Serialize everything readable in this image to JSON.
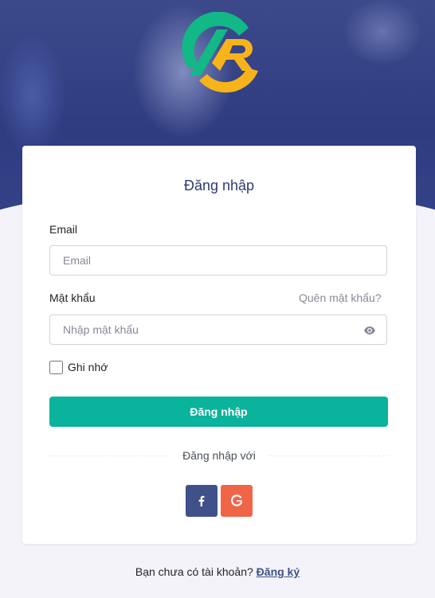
{
  "login": {
    "title": "Đăng nhập",
    "email_label": "Email",
    "email_placeholder": "Email",
    "password_label": "Mật khẩu",
    "forgot_link": "Quên mật khẩu?",
    "password_placeholder": "Nhập mật khẩu",
    "remember_label": "Ghi nhớ",
    "submit_label": "Đăng nhập",
    "divider_text": "Đăng nhập với",
    "social": {
      "facebook_icon": "facebook-icon",
      "google_icon": "google-icon"
    }
  },
  "footer": {
    "prompt": "Bạn chưa có tài khoản?",
    "register_link": "Đăng ký"
  },
  "colors": {
    "primary": "#0ab39c",
    "hero": "#2f3c80",
    "facebook": "#405189",
    "google": "#f06548",
    "logo_green": "#12b886",
    "logo_orange": "#f7b31a"
  }
}
